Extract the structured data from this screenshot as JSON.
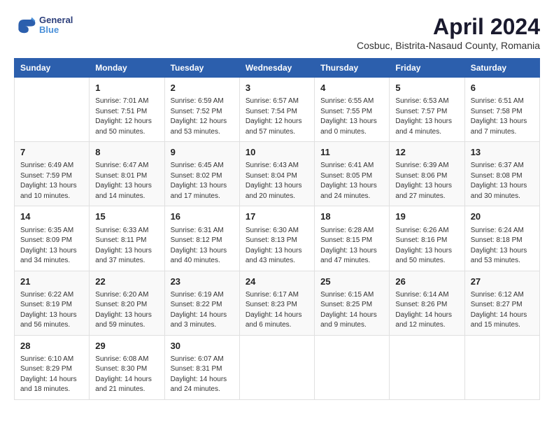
{
  "header": {
    "logo_line1": "General",
    "logo_line2": "Blue",
    "month_title": "April 2024",
    "subtitle": "Cosbuc, Bistrita-Nasaud County, Romania"
  },
  "columns": [
    "Sunday",
    "Monday",
    "Tuesday",
    "Wednesday",
    "Thursday",
    "Friday",
    "Saturday"
  ],
  "weeks": [
    [
      {
        "day": "",
        "info": ""
      },
      {
        "day": "1",
        "info": "Sunrise: 7:01 AM\nSunset: 7:51 PM\nDaylight: 12 hours\nand 50 minutes."
      },
      {
        "day": "2",
        "info": "Sunrise: 6:59 AM\nSunset: 7:52 PM\nDaylight: 12 hours\nand 53 minutes."
      },
      {
        "day": "3",
        "info": "Sunrise: 6:57 AM\nSunset: 7:54 PM\nDaylight: 12 hours\nand 57 minutes."
      },
      {
        "day": "4",
        "info": "Sunrise: 6:55 AM\nSunset: 7:55 PM\nDaylight: 13 hours\nand 0 minutes."
      },
      {
        "day": "5",
        "info": "Sunrise: 6:53 AM\nSunset: 7:57 PM\nDaylight: 13 hours\nand 4 minutes."
      },
      {
        "day": "6",
        "info": "Sunrise: 6:51 AM\nSunset: 7:58 PM\nDaylight: 13 hours\nand 7 minutes."
      }
    ],
    [
      {
        "day": "7",
        "info": "Sunrise: 6:49 AM\nSunset: 7:59 PM\nDaylight: 13 hours\nand 10 minutes."
      },
      {
        "day": "8",
        "info": "Sunrise: 6:47 AM\nSunset: 8:01 PM\nDaylight: 13 hours\nand 14 minutes."
      },
      {
        "day": "9",
        "info": "Sunrise: 6:45 AM\nSunset: 8:02 PM\nDaylight: 13 hours\nand 17 minutes."
      },
      {
        "day": "10",
        "info": "Sunrise: 6:43 AM\nSunset: 8:04 PM\nDaylight: 13 hours\nand 20 minutes."
      },
      {
        "day": "11",
        "info": "Sunrise: 6:41 AM\nSunset: 8:05 PM\nDaylight: 13 hours\nand 24 minutes."
      },
      {
        "day": "12",
        "info": "Sunrise: 6:39 AM\nSunset: 8:06 PM\nDaylight: 13 hours\nand 27 minutes."
      },
      {
        "day": "13",
        "info": "Sunrise: 6:37 AM\nSunset: 8:08 PM\nDaylight: 13 hours\nand 30 minutes."
      }
    ],
    [
      {
        "day": "14",
        "info": "Sunrise: 6:35 AM\nSunset: 8:09 PM\nDaylight: 13 hours\nand 34 minutes."
      },
      {
        "day": "15",
        "info": "Sunrise: 6:33 AM\nSunset: 8:11 PM\nDaylight: 13 hours\nand 37 minutes."
      },
      {
        "day": "16",
        "info": "Sunrise: 6:31 AM\nSunset: 8:12 PM\nDaylight: 13 hours\nand 40 minutes."
      },
      {
        "day": "17",
        "info": "Sunrise: 6:30 AM\nSunset: 8:13 PM\nDaylight: 13 hours\nand 43 minutes."
      },
      {
        "day": "18",
        "info": "Sunrise: 6:28 AM\nSunset: 8:15 PM\nDaylight: 13 hours\nand 47 minutes."
      },
      {
        "day": "19",
        "info": "Sunrise: 6:26 AM\nSunset: 8:16 PM\nDaylight: 13 hours\nand 50 minutes."
      },
      {
        "day": "20",
        "info": "Sunrise: 6:24 AM\nSunset: 8:18 PM\nDaylight: 13 hours\nand 53 minutes."
      }
    ],
    [
      {
        "day": "21",
        "info": "Sunrise: 6:22 AM\nSunset: 8:19 PM\nDaylight: 13 hours\nand 56 minutes."
      },
      {
        "day": "22",
        "info": "Sunrise: 6:20 AM\nSunset: 8:20 PM\nDaylight: 13 hours\nand 59 minutes."
      },
      {
        "day": "23",
        "info": "Sunrise: 6:19 AM\nSunset: 8:22 PM\nDaylight: 14 hours\nand 3 minutes."
      },
      {
        "day": "24",
        "info": "Sunrise: 6:17 AM\nSunset: 8:23 PM\nDaylight: 14 hours\nand 6 minutes."
      },
      {
        "day": "25",
        "info": "Sunrise: 6:15 AM\nSunset: 8:25 PM\nDaylight: 14 hours\nand 9 minutes."
      },
      {
        "day": "26",
        "info": "Sunrise: 6:14 AM\nSunset: 8:26 PM\nDaylight: 14 hours\nand 12 minutes."
      },
      {
        "day": "27",
        "info": "Sunrise: 6:12 AM\nSunset: 8:27 PM\nDaylight: 14 hours\nand 15 minutes."
      }
    ],
    [
      {
        "day": "28",
        "info": "Sunrise: 6:10 AM\nSunset: 8:29 PM\nDaylight: 14 hours\nand 18 minutes."
      },
      {
        "day": "29",
        "info": "Sunrise: 6:08 AM\nSunset: 8:30 PM\nDaylight: 14 hours\nand 21 minutes."
      },
      {
        "day": "30",
        "info": "Sunrise: 6:07 AM\nSunset: 8:31 PM\nDaylight: 14 hours\nand 24 minutes."
      },
      {
        "day": "",
        "info": ""
      },
      {
        "day": "",
        "info": ""
      },
      {
        "day": "",
        "info": ""
      },
      {
        "day": "",
        "info": ""
      }
    ]
  ]
}
